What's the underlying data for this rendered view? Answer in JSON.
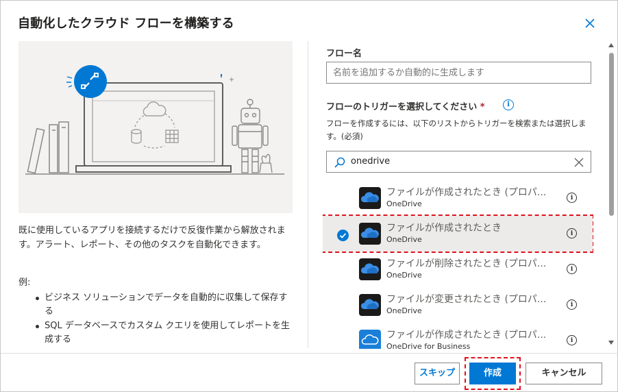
{
  "dialog": {
    "title": "自動化したクラウド フローを構築する",
    "close_icon": "close-icon"
  },
  "left": {
    "description": "既に使用しているアプリを接続するだけで反復作業から解放されます。アラート、レポート、その他のタスクを自動化できます。",
    "example_label": "例:",
    "examples": [
      "ビジネス ソリューションでデータを自動的に収集して保存する",
      "SQL データベースでカスタム クエリを使用してレポートを生成する"
    ]
  },
  "form": {
    "flow_name_label": "フロー名",
    "flow_name_placeholder": "名前を追加するか自動的に生成します",
    "trigger_label": "フローのトリガーを選択してください",
    "required_mark": "*",
    "hint": "フローを作成するには、以下のリストからトリガーを検索または選択します。(必須)",
    "search_value": "onedrive"
  },
  "triggers": [
    {
      "title": "ファイルが作成されたとき (プロパ...",
      "app": "OneDrive",
      "selected": false
    },
    {
      "title": "ファイルが作成されたとき",
      "app": "OneDrive",
      "selected": true
    },
    {
      "title": "ファイルが削除されたとき (プロパ...",
      "app": "OneDrive",
      "selected": false
    },
    {
      "title": "ファイルが変更されたとき (プロパ...",
      "app": "OneDrive",
      "selected": false
    },
    {
      "title": "ファイルが作成されたとき (プロパ...",
      "app": "OneDrive for Business",
      "selected": false
    }
  ],
  "footer": {
    "skip_label": "スキップ",
    "create_label": "作成",
    "cancel_label": "キャンセル"
  },
  "colors": {
    "accent": "#0078d4",
    "highlight_outline": "#e0101a"
  }
}
